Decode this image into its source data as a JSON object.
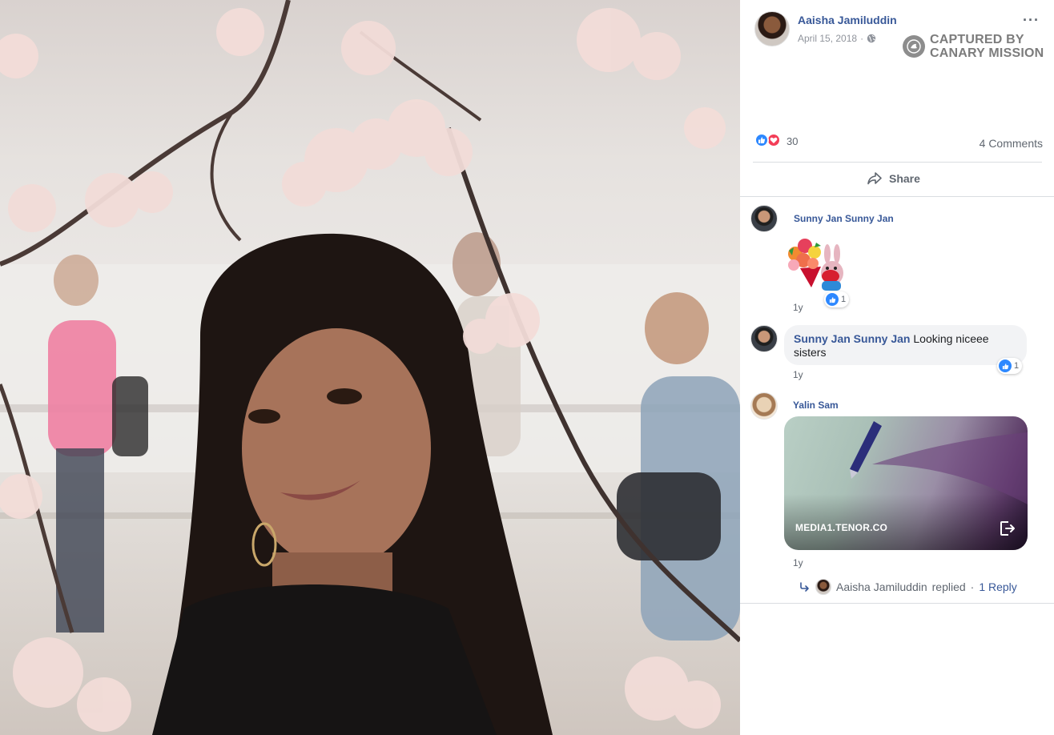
{
  "post": {
    "author": "Aaisha Jamiluddin",
    "date": "April 15, 2018",
    "date_separator": "·",
    "privacy_icon": "globe-icon",
    "more_label": "···"
  },
  "watermark": {
    "text": "CAPTURED BY\nCANARY MISSION"
  },
  "reactions": {
    "count": "30",
    "types": [
      "like",
      "love"
    ],
    "comments_label": "4 Comments"
  },
  "actions": {
    "share_label": "Share"
  },
  "comments": [
    {
      "author": "Sunny Jan Sunny Jan",
      "type": "sticker",
      "time": "1y",
      "reaction_count": "1"
    },
    {
      "author": "Sunny Jan Sunny Jan",
      "text": "Looking niceee sisters",
      "time": "1y",
      "reaction_count": "1"
    },
    {
      "author": "Yalin Sam",
      "type": "gif",
      "gif_domain": "MEDIA1.TENOR.CO",
      "time": "1y",
      "replies": {
        "replier": "Aaisha Jamiluddin",
        "replied_label": "replied",
        "separator": "·",
        "link_label": "1 Reply"
      }
    }
  ],
  "colors": {
    "link_blue": "#385898",
    "like_blue": "#2d88ff",
    "love_red": "#f33e58",
    "meta_gray": "#606770"
  }
}
